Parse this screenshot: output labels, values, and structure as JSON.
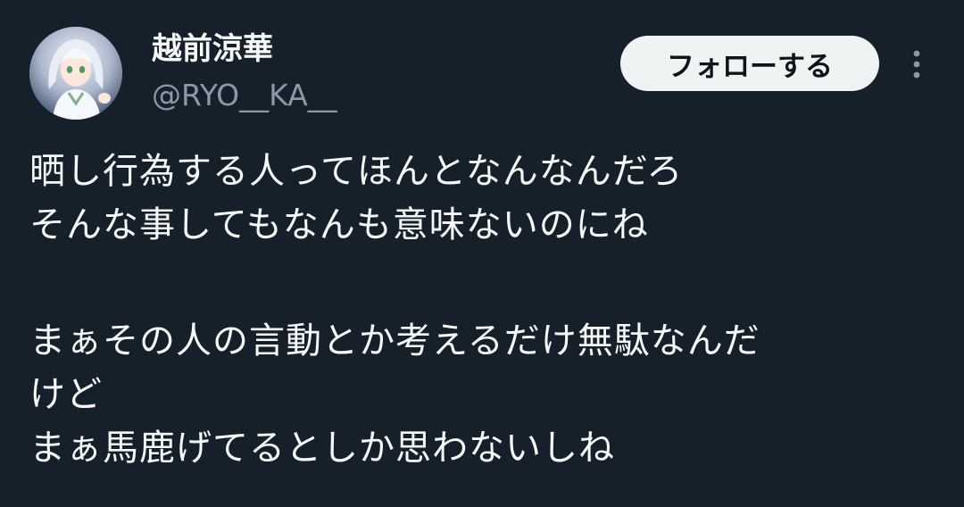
{
  "author": {
    "display_name": "越前涼華",
    "handle": "@RYO__KA__",
    "avatar_icon": "anime-avatar-icon"
  },
  "actions": {
    "follow_label": "フォローする",
    "more_icon": "more-vertical-icon"
  },
  "tweet": {
    "paragraph1": [
      "晒し行為する人ってほんとなんなんだろ",
      "そんな事してもなんも意味ないのにね"
    ],
    "paragraph2": [
      "まぁその人の言動とか考えるだけ無駄なんだ",
      "けど",
      "まぁ馬鹿げてるとしか思わないしね"
    ]
  },
  "colors": {
    "background": "#15202b",
    "text_primary": "#f7f9f9",
    "text_secondary": "#8b98a5",
    "button_bg": "#eff3f4",
    "button_text": "#0f1419"
  }
}
